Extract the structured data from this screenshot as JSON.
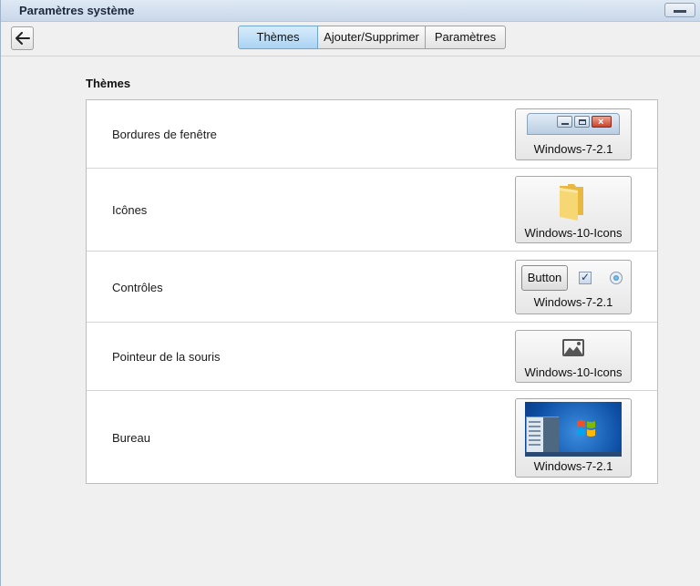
{
  "window": {
    "title": "Paramètres système"
  },
  "toolbar": {
    "tabs": [
      {
        "label": "Thèmes",
        "active": true
      },
      {
        "label": "Ajouter/Supprimer",
        "active": false
      },
      {
        "label": "Paramètres",
        "active": false
      }
    ]
  },
  "main": {
    "section_title": "Thèmes",
    "rows": [
      {
        "label": "Bordures de fenêtre",
        "theme": "Windows-7-2.1",
        "preview_icon": "window-border-preview-icon"
      },
      {
        "label": "Icônes",
        "theme": "Windows-10-Icons",
        "preview_icon": "folder-icon"
      },
      {
        "label": "Contrôles",
        "theme": "Windows-7-2.1",
        "preview_icon": "controls-preview-icon",
        "preview_button_label": "Button"
      },
      {
        "label": "Pointeur de la souris",
        "theme": "Windows-10-Icons",
        "preview_icon": "image-icon"
      },
      {
        "label": "Bureau",
        "theme": "Windows-7-2.1",
        "preview_icon": "desktop-wallpaper-preview"
      }
    ]
  },
  "colors": {
    "active_tab": "#a9d3f3",
    "folder": "#f5d26a",
    "desktop_blue": "#1f6fd0"
  }
}
